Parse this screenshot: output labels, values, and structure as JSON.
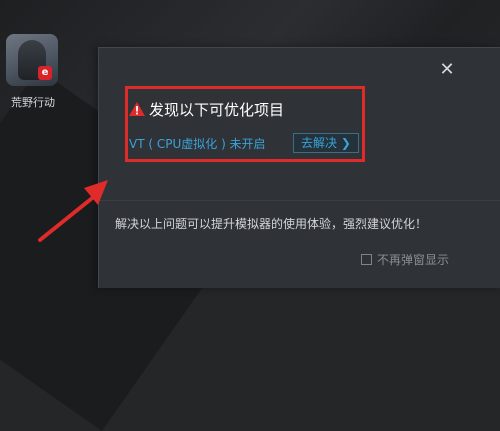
{
  "desktop": {
    "app_label": "荒野行动",
    "app_logo_letter": "e"
  },
  "dialog": {
    "close_icon": "close-icon",
    "close_glyph": "✕",
    "warning_title": "发现以下可优化项目",
    "issue_text": "VT ( CPU虚拟化 ) 未开启",
    "fix_button_label": "去解决",
    "fix_button_glyph": "❯",
    "info_text": "解决以上问题可以提升模拟器的使用体验，强烈建议优化！",
    "no_more_popup_label": "不再弹窗显示",
    "no_more_popup_checked": false
  },
  "colors": {
    "annotation_red": "#e02b2b",
    "link_blue": "#3aa3d8",
    "dialog_bg": "#2f3236"
  }
}
